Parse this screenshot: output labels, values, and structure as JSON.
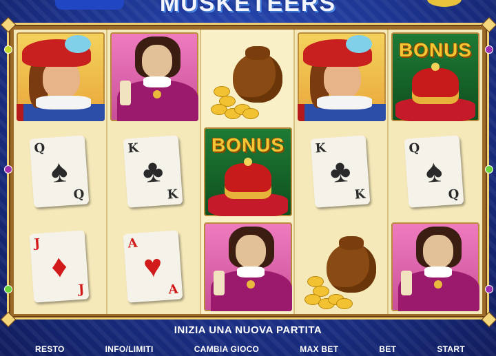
{
  "game": {
    "title": "MUSKETEERS",
    "status_message": "INIZIA UNA NUOVA PARTITA"
  },
  "reels": [
    [
      {
        "symbol": "musketeer",
        "icon": "musketeer-icon"
      },
      {
        "symbol": "card",
        "rank": "Q",
        "suit": "♠",
        "color": "black"
      },
      {
        "symbol": "card",
        "rank": "J",
        "suit": "♦",
        "color": "red"
      }
    ],
    [
      {
        "symbol": "cardinal",
        "icon": "cardinal-icon"
      },
      {
        "symbol": "card",
        "rank": "K",
        "suit": "♣",
        "color": "black"
      },
      {
        "symbol": "card",
        "rank": "A",
        "suit": "♥",
        "color": "red"
      }
    ],
    [
      {
        "symbol": "gold-bag",
        "icon": "gold-bag-icon"
      },
      {
        "symbol": "bonus",
        "label": "BONUS",
        "icon": "crown-icon"
      },
      {
        "symbol": "cardinal",
        "icon": "cardinal-icon"
      }
    ],
    [
      {
        "symbol": "musketeer",
        "icon": "musketeer-icon"
      },
      {
        "symbol": "card",
        "rank": "K",
        "suit": "♣",
        "color": "black"
      },
      {
        "symbol": "gold-bag",
        "icon": "gold-bag-icon"
      }
    ],
    [
      {
        "symbol": "bonus",
        "label": "BONUS",
        "icon": "crown-icon"
      },
      {
        "symbol": "card",
        "rank": "Q",
        "suit": "♠",
        "color": "black"
      },
      {
        "symbol": "cardinal",
        "icon": "cardinal-icon"
      }
    ]
  ],
  "controls": {
    "resto": "RESTO",
    "info": "INFO/LIMITI",
    "cambia": "CAMBIA GIOCO",
    "maxbet": "MAX BET",
    "bet": "BET",
    "start": "START"
  },
  "colors": {
    "background": "#1b2f86",
    "frame_gold": "#f1cf73",
    "reel_bg": "#f6e9b9",
    "bonus_gold": "#f3c634"
  }
}
